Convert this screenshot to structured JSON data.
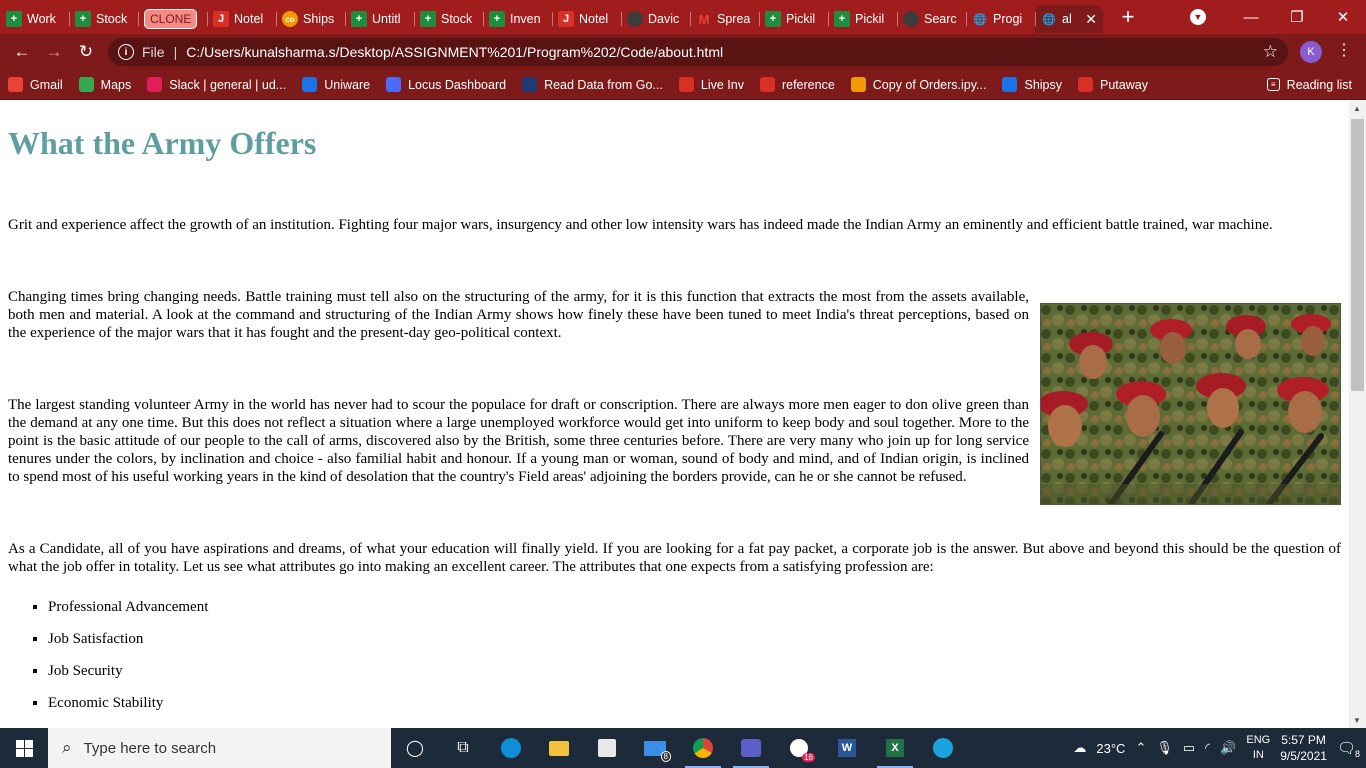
{
  "browser": {
    "tabs": [
      {
        "label": "Work",
        "icon": "sheets-icon",
        "kind": "green"
      },
      {
        "label": "Stock",
        "icon": "sheets-icon",
        "kind": "green"
      },
      {
        "label": "CLONE",
        "icon": "",
        "kind": "pill"
      },
      {
        "label": "Notel",
        "icon": "notebook-icon",
        "kind": "red"
      },
      {
        "label": "Ships",
        "icon": "colab-icon",
        "kind": "orange"
      },
      {
        "label": "Untitl",
        "icon": "sheets-icon",
        "kind": "green"
      },
      {
        "label": "Stock",
        "icon": "sheets-icon",
        "kind": "green"
      },
      {
        "label": "Inven",
        "icon": "sheets-icon",
        "kind": "green"
      },
      {
        "label": "Notel",
        "icon": "notebook-icon",
        "kind": "red"
      },
      {
        "label": "Davic",
        "icon": "github-icon",
        "kind": "dark"
      },
      {
        "label": "Sprea",
        "icon": "gmail-icon",
        "kind": "gmail"
      },
      {
        "label": "Pickil",
        "icon": "sheets-icon",
        "kind": "green"
      },
      {
        "label": "Pickil",
        "icon": "sheets-icon",
        "kind": "green"
      },
      {
        "label": "Searc",
        "icon": "github-icon",
        "kind": "dark"
      },
      {
        "label": "Progi",
        "icon": "globe-icon",
        "kind": "globe"
      },
      {
        "label": "al",
        "icon": "globe-icon",
        "kind": "globe",
        "active": true
      }
    ],
    "url_scheme": "File",
    "url": "C:/Users/kunalsharma.s/Desktop/ASSIGNMENT%201/Program%202/Code/about.html",
    "profile_initial": "K",
    "bookmarks": [
      {
        "label": "Gmail",
        "icon": "gmail-icon",
        "color": "#ea4335"
      },
      {
        "label": "Maps",
        "icon": "maps-icon",
        "color": "#34a853"
      },
      {
        "label": "Slack | general | ud...",
        "icon": "slack-icon",
        "color": "#e01e5a"
      },
      {
        "label": "Uniware",
        "icon": "uniware-icon",
        "color": "#1a73e8"
      },
      {
        "label": "Locus Dashboard",
        "icon": "locus-icon",
        "color": "#4a6cf7"
      },
      {
        "label": "Read Data from Go...",
        "icon": "tds-icon",
        "color": "#1f3b73"
      },
      {
        "label": "Live Inv",
        "icon": "notebook-icon",
        "color": "#d93025"
      },
      {
        "label": "reference",
        "icon": "notebook-icon",
        "color": "#d93025"
      },
      {
        "label": "Copy of Orders.ipy...",
        "icon": "colab-icon",
        "color": "#f29900"
      },
      {
        "label": "Shipsy",
        "icon": "shipsy-icon",
        "color": "#1a73e8"
      },
      {
        "label": "Putaway",
        "icon": "notebook-icon",
        "color": "#d93025"
      }
    ],
    "reading_list": "Reading list"
  },
  "page": {
    "heading": "What the Army Offers",
    "paragraphs": [
      "Grit and experience affect the growth of an institution. Fighting four major wars, insurgency and other low intensity wars has indeed made the Indian Army an eminently and efficient battle trained, war machine.",
      "Changing times bring changing needs. Battle training must tell also on the structuring of the army, for it is this function that extracts the most from the assets available, both men and material. A look at the command and structuring of the Indian Army shows how finely these have been tuned to meet India's threat perceptions, based on the experience of the major wars that it has fought and the present-day geo-political context.",
      "The largest standing volunteer Army in the world has never had to scour the populace for draft or conscription. There are always more men eager to don olive green than the demand at any one time. But this does not reflect a situation where a large unemployed workforce would get into uniform to keep body and soul together. More to the point is the basic attitude of our people to the call of arms, discovered also by the British, some three centuries before. There are very many who join up for long service tenures under the colors, by inclination and choice - also familial habit and honour. If a young man or woman, sound of body and mind, and of Indian origin, is inclined to spend most of his useful working years in the kind of desolation that the country's Field areas' adjoining the borders provide, can he or she cannot be refused.",
      "As a Candidate, all of you have aspirations and dreams, of what your education will finally yield. If you are looking for a fat pay packet, a corporate job is the answer. But above and beyond this should be the question of what the job offer in totality. Let us see what attributes go into making an excellent career. The attributes that one expects from a satisfying profession are:"
    ],
    "attributes": [
      "Professional Advancement",
      "Job Satisfaction",
      "Job Security",
      "Economic Stability"
    ]
  },
  "taskbar": {
    "search_placeholder": "Type here to search",
    "mail_badge": "8",
    "teams_badge": "16",
    "weather": "23°C",
    "lang_top": "ENG",
    "lang_bottom": "IN",
    "time": "5:57 PM",
    "date": "9/5/2021",
    "notifications": "8"
  }
}
